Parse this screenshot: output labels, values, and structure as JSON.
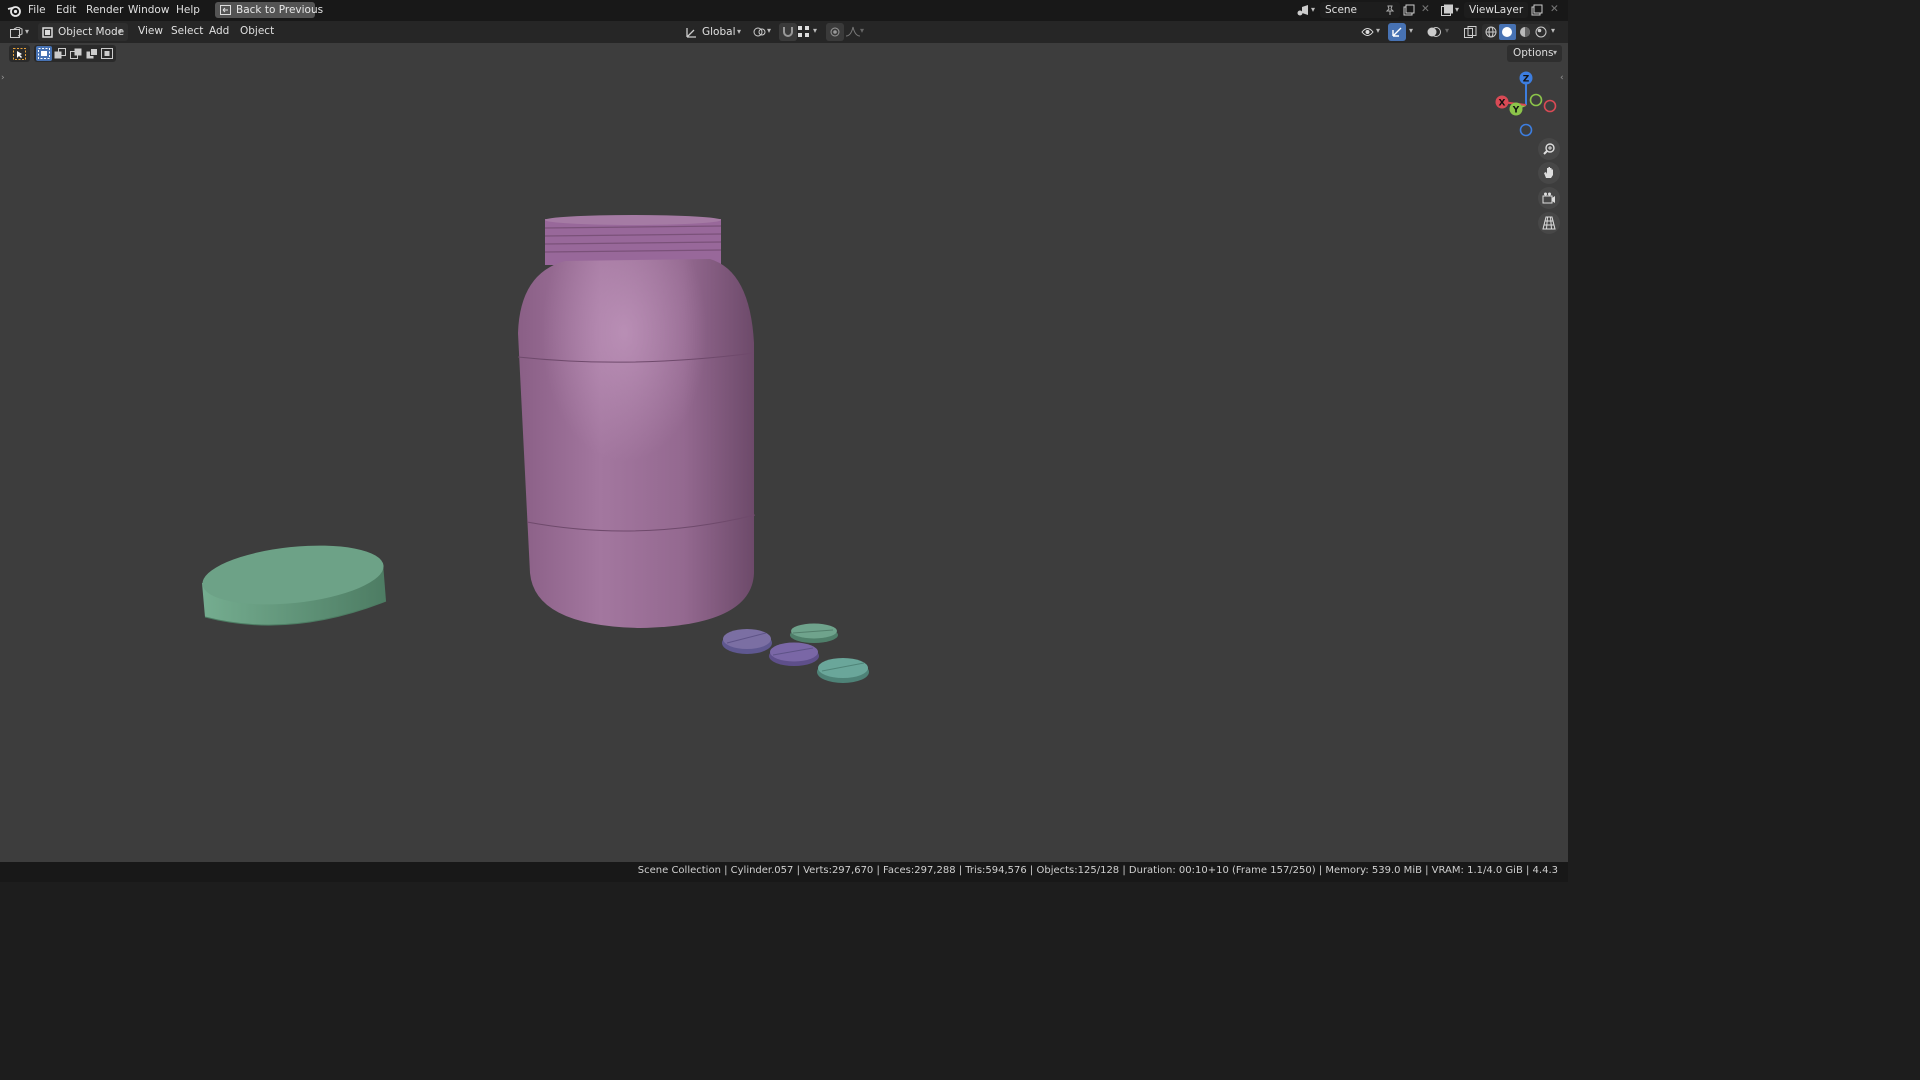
{
  "topbar": {
    "menus": [
      "File",
      "Edit",
      "Render",
      "Window",
      "Help"
    ],
    "back_button": "Back to Previous",
    "scene_name": "Scene",
    "view_layer": "ViewLayer"
  },
  "header": {
    "mode": "Object Mode",
    "menus": [
      "View",
      "Select",
      "Add",
      "Object"
    ],
    "transform_orientation": "Global",
    "options_label": "Options"
  },
  "gizmo": {
    "x": "X",
    "y": "Y",
    "z": "Z"
  },
  "icons": [
    "blender-logo-icon",
    "back-icon",
    "editor-type-icon",
    "object-mode-icon",
    "transform-orientation-icon",
    "pivot-icon",
    "snap-icon",
    "snap-target-icon",
    "proportional-edit-icon",
    "falloff-icon",
    "visibility-icon",
    "gizmo-icon",
    "overlay-icon",
    "xray-icon",
    "wireframe-shading-icon",
    "solid-shading-icon",
    "material-shading-icon",
    "rendered-shading-icon",
    "zoom-icon",
    "pan-hand-icon",
    "camera-icon",
    "grid-icon",
    "scene-icon",
    "pin-icon",
    "new-scene-icon",
    "delete-icon",
    "view-layer-icon",
    "tweak-tool-icon",
    "select-box-icon",
    "select-extend-icon",
    "select-subtract-icon",
    "select-invert-icon",
    "select-intersect-icon"
  ],
  "colors": {
    "viewport_bg": "#3d3d3d",
    "jar": "#9a6c96",
    "cap": "#6a9f84",
    "pill_purple": "#7b6fa3",
    "pill_green": "#6fa38c",
    "axis_x": "#d94a55",
    "axis_y": "#8cc44a",
    "axis_z": "#3d7ee0",
    "accent": "#4772b3"
  },
  "status": "Scene Collection | Cylinder.057 | Verts:297,670 | Faces:297,288 | Tris:594,576 | Objects:125/128 | Duration: 00:10+10 (Frame 157/250) | Memory: 539.0 MiB | VRAM: 1.1/4.0 GiB | 4.4.3"
}
